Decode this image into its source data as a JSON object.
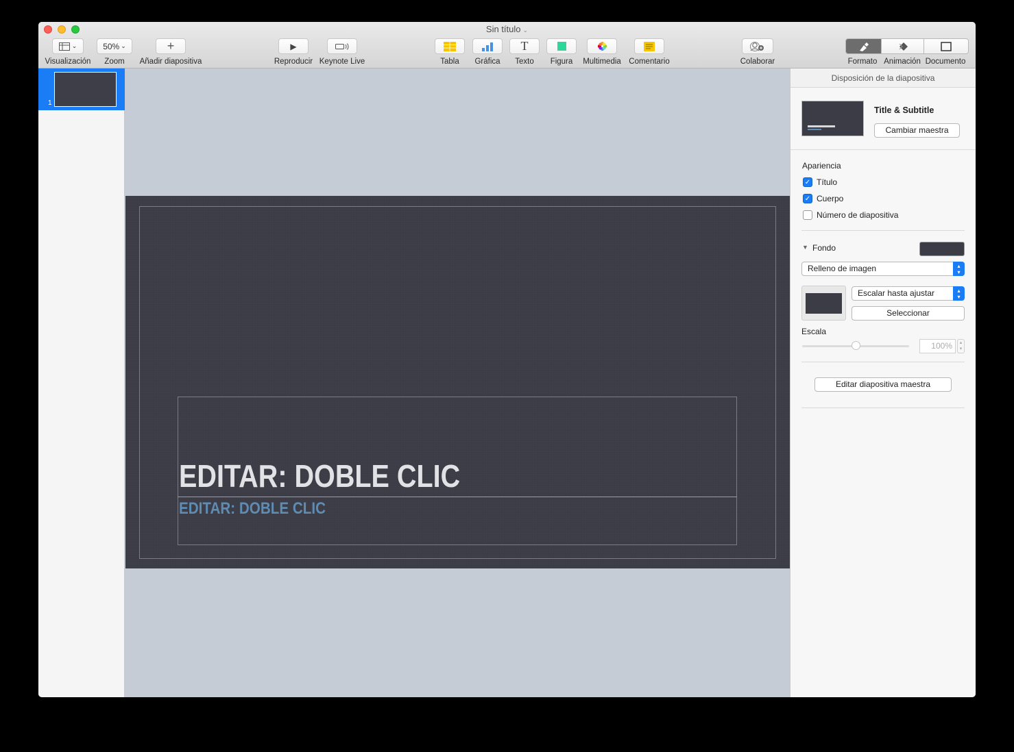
{
  "window": {
    "title": "Sin título"
  },
  "toolbar": {
    "view_label": "Visualización",
    "zoom_value": "50%",
    "zoom_label": "Zoom",
    "add_slide_label": "Añadir diapositiva",
    "play_label": "Reproducir",
    "keynote_live_label": "Keynote Live",
    "table_label": "Tabla",
    "chart_label": "Gráfica",
    "text_label": "Texto",
    "shape_label": "Figura",
    "media_label": "Multimedia",
    "comment_label": "Comentario",
    "collaborate_label": "Colaborar",
    "format_label": "Formato",
    "animate_label": "Animación",
    "document_label": "Documento"
  },
  "navigator": {
    "slides": [
      {
        "number": "1"
      }
    ]
  },
  "slide": {
    "title": "EDITAR: DOBLE CLIC",
    "subtitle": "EDITAR: DOBLE CLIC"
  },
  "inspector": {
    "header": "Disposición de la diapositiva",
    "master_name": "Title & Subtitle",
    "change_master_label": "Cambiar maestra",
    "appearance_label": "Apariencia",
    "checkboxes": [
      {
        "label": "Título",
        "checked": true
      },
      {
        "label": "Cuerpo",
        "checked": true
      },
      {
        "label": "Número de diapositiva",
        "checked": false
      }
    ],
    "background_label": "Fondo",
    "background_color": "#3b3c45",
    "fill_type": "Relleno de imagen",
    "scale_mode": "Escalar hasta ajustar",
    "choose_label": "Seleccionar",
    "scale_label": "Escala",
    "scale_value": "100%",
    "scale_slider_value": 0.5,
    "edit_master_label": "Editar diapositiva maestra"
  },
  "colors": {
    "accent": "#1a7df6",
    "slide_bg": "#3b3c45",
    "subtitle": "#5f8cb3"
  }
}
